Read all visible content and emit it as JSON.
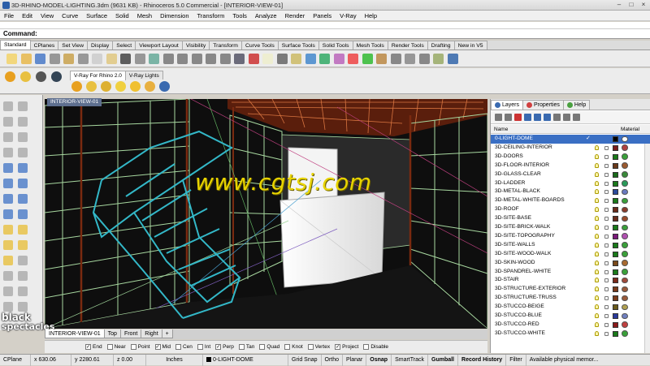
{
  "window": {
    "title": "3D-RHINO-MODEL-LIGHTING.3dm (9631 KB) - Rhinoceros 5.0 Commercial - [INTERIOR-VIEW-01]",
    "min": "–",
    "max": "□",
    "close": "×"
  },
  "menu": [
    "File",
    "Edit",
    "View",
    "Curve",
    "Surface",
    "Solid",
    "Mesh",
    "Dimension",
    "Transform",
    "Tools",
    "Analyze",
    "Render",
    "Panels",
    "V-Ray",
    "Help"
  ],
  "command": {
    "label": "Command:"
  },
  "toolbar_tabs": [
    "Standard",
    "CPlanes",
    "Set View",
    "Display",
    "Select",
    "Viewport Layout",
    "Visibility",
    "Transform",
    "Curve Tools",
    "Surface Tools",
    "Solid Tools",
    "Mesh Tools",
    "Render Tools",
    "Drafting",
    "New in V5"
  ],
  "vray_tabs": [
    "V-Ray For Rhino 2.0",
    "V-Ray Lights"
  ],
  "viewport": {
    "title": "INTERIOR-VIEW-01"
  },
  "viewport_tabs": [
    "INTERIOR-VIEW-01",
    "Top",
    "Front",
    "Right",
    "+"
  ],
  "osnap": [
    {
      "label": "End",
      "checked": true
    },
    {
      "label": "Near",
      "checked": false
    },
    {
      "label": "Point",
      "checked": false
    },
    {
      "label": "Mid",
      "checked": true
    },
    {
      "label": "Cen",
      "checked": false
    },
    {
      "label": "Int",
      "checked": false
    },
    {
      "label": "Perp",
      "checked": true
    },
    {
      "label": "Tan",
      "checked": false
    },
    {
      "label": "Quad",
      "checked": false
    },
    {
      "label": "Knot",
      "checked": false
    },
    {
      "label": "Vertex",
      "checked": false
    },
    {
      "label": "Project",
      "checked": true
    },
    {
      "label": "Disable",
      "checked": false
    }
  ],
  "status": {
    "cplane": "CPlane",
    "x": "x 630.06",
    "y": "y 2280.61",
    "z": "z 0.00",
    "units": "Inches",
    "layer": "0-LIGHT-DOME",
    "grid_snap": "Grid Snap",
    "ortho": "Ortho",
    "planar": "Planar",
    "osnap": "Osnap",
    "smarttrack": "SmartTrack",
    "gumball": "Gumball",
    "record_history": "Record History",
    "filter": "Filter",
    "memory": "Available physical memor..."
  },
  "panel": {
    "tabs": [
      "Layers",
      "Properties",
      "Help"
    ],
    "col_name": "Name",
    "col_material": "Material",
    "layers": [
      {
        "name": "0-LIGHT-DOME",
        "current": true,
        "color": "#000000",
        "mat": "#ffffff"
      },
      {
        "name": "3D-CEILING-INTERIOR",
        "color": "#7a1c1c",
        "mat": "#b04040"
      },
      {
        "name": "3D-DOORS",
        "color": "#1a7a1a",
        "mat": "#3aa03a"
      },
      {
        "name": "3D-FLOOR-INTERIOR",
        "color": "#6a3a1a",
        "mat": "#9a5a30"
      },
      {
        "name": "3D-GLASS-CLEAR",
        "color": "#1a6a1a",
        "mat": "#3a8a3a"
      },
      {
        "name": "3D-LADDER",
        "color": "#1a7a1a",
        "mat": "#2a9a5a"
      },
      {
        "name": "3D-METAL-BLACK",
        "color": "#2a4a9a",
        "mat": "#6a7ac0"
      },
      {
        "name": "3D-METAL-WHITE-BOARDS",
        "color": "#1a7a1a",
        "mat": "#3aa03a"
      },
      {
        "name": "3D-ROOF",
        "color": "#6a2a1a",
        "mat": "#8a3a2a"
      },
      {
        "name": "3D-SITE-BASE",
        "color": "#6a2a1a",
        "mat": "#9a4a2a"
      },
      {
        "name": "3D-SITE-BRICK-WALK",
        "color": "#1a7a1a",
        "mat": "#3aa03a"
      },
      {
        "name": "3D-SITE-TOPOGRAPHY",
        "color": "#7a1a7a",
        "mat": "#b050b0"
      },
      {
        "name": "3D-SITE-WALLS",
        "color": "#1a7a1a",
        "mat": "#3aa03a"
      },
      {
        "name": "3D-SITE-WOOD-WALK",
        "color": "#1a7a1a",
        "mat": "#3aa03a"
      },
      {
        "name": "3D-SKIN-WOOD",
        "color": "#7a4a1a",
        "mat": "#a86a30"
      },
      {
        "name": "3D-SPANDREL-WHITE",
        "color": "#1a7a1a",
        "mat": "#3aa03a"
      },
      {
        "name": "3D-STAIR",
        "color": "#7a2a1a",
        "mat": "#a04a3a"
      },
      {
        "name": "3D-STRUCTURE-EXTERIOR",
        "color": "#7a3a1a",
        "mat": "#9a5a3a"
      },
      {
        "name": "3D-STRUCTURE-TRUSS",
        "color": "#7a3a1a",
        "mat": "#9a5a3a"
      },
      {
        "name": "3D-STUCCO-BEIGE",
        "color": "#6a5a1a",
        "mat": "#b0a050"
      },
      {
        "name": "3D-STUCCO-BLUE",
        "color": "#2a3a9a",
        "mat": "#7080c0"
      },
      {
        "name": "3D-STUCCO-RED",
        "color": "#8a1a1a",
        "mat": "#c04040"
      },
      {
        "name": "3D-STUCCO-WHITE",
        "color": "#1a7a1a",
        "mat": "#3aa03a"
      }
    ]
  },
  "watermark": "www.cgtsj.com",
  "logo": {
    "line1": "black",
    "line2": "spectacles"
  }
}
